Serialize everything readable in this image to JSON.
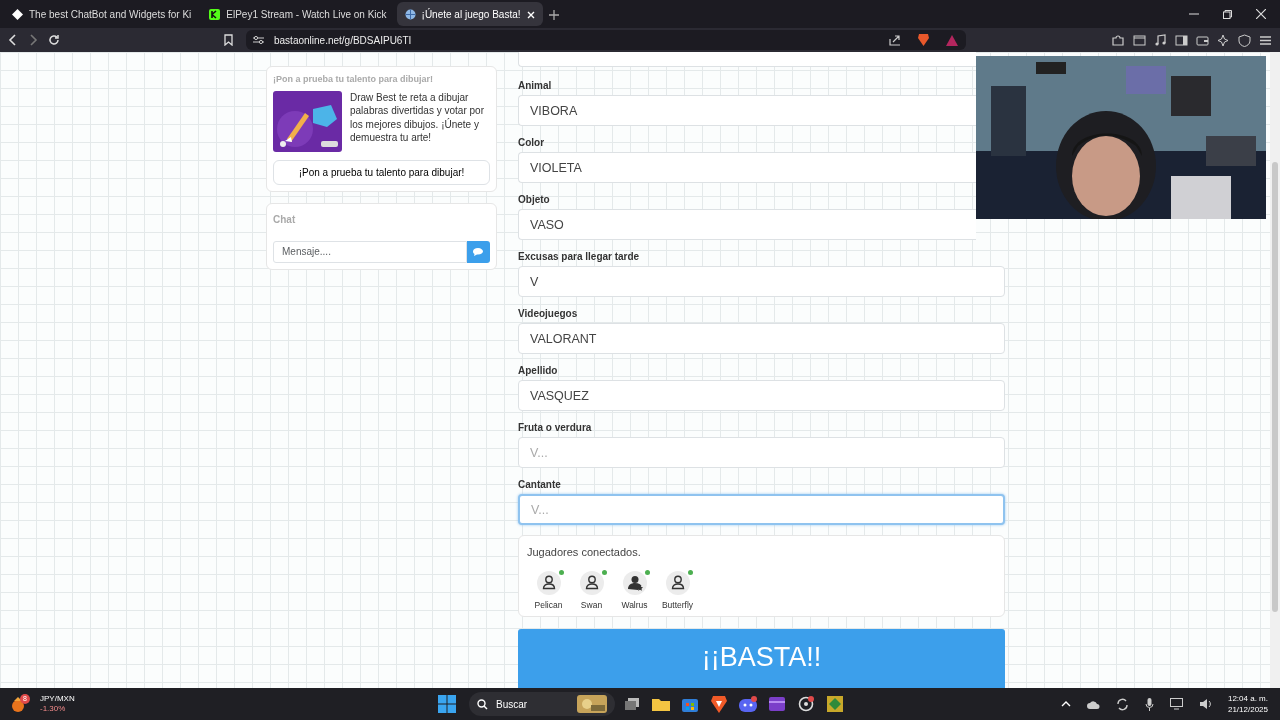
{
  "browser": {
    "tabs": [
      {
        "title": "The best ChatBot and Widgets for Ki",
        "selected": false
      },
      {
        "title": "ElPey1 Stream - Watch Live on Kick",
        "selected": false
      },
      {
        "title": "¡Únete al juego Basta!",
        "selected": true
      }
    ],
    "url": "bastaonline.net/g/BDSAIPU6TI"
  },
  "sidebar": {
    "promo": {
      "heading": "¡Pon a prueba tu talento para dibujar!",
      "description": "Draw Best te reta a dibujar palabras divertidas y votar por los mejores dibujos. ¡Únete y demuestra tu arte!",
      "button": "¡Pon a prueba tu talento para dibujar!"
    },
    "chat": {
      "title": "Chat",
      "placeholder": "Mensaje...."
    }
  },
  "form": {
    "fields": [
      {
        "label": "Animal",
        "value": "VIBORA",
        "focused": false
      },
      {
        "label": "Color",
        "value": "VIOLETA",
        "focused": false
      },
      {
        "label": "Objeto",
        "value": "VASO",
        "focused": false
      },
      {
        "label": "Excusas para llegar tarde",
        "value": "V",
        "focused": false
      },
      {
        "label": "Videojuegos",
        "value": "VALORANT",
        "focused": false
      },
      {
        "label": "Apellido",
        "value": "VASQUEZ",
        "focused": false
      },
      {
        "label": "Fruta o verdura",
        "placeholder": "V...",
        "focused": false
      },
      {
        "label": "Cantante",
        "placeholder": "V...",
        "focused": true
      }
    ]
  },
  "players": {
    "title": "Jugadores conectados.",
    "items": [
      {
        "name": "Pelican",
        "online": true,
        "host": false
      },
      {
        "name": "Swan",
        "online": true,
        "host": false
      },
      {
        "name": "Walrus",
        "online": true,
        "host": true
      },
      {
        "name": "Butterfly",
        "online": true,
        "host": false
      }
    ]
  },
  "basta_button": "¡¡BASTA!!",
  "taskbar": {
    "widget": {
      "badge": "8",
      "title": "JPY/MXN",
      "change": "-1.30%"
    },
    "search_placeholder": "Buscar",
    "time": "12:04 a. m.",
    "date": "21/12/2025"
  }
}
